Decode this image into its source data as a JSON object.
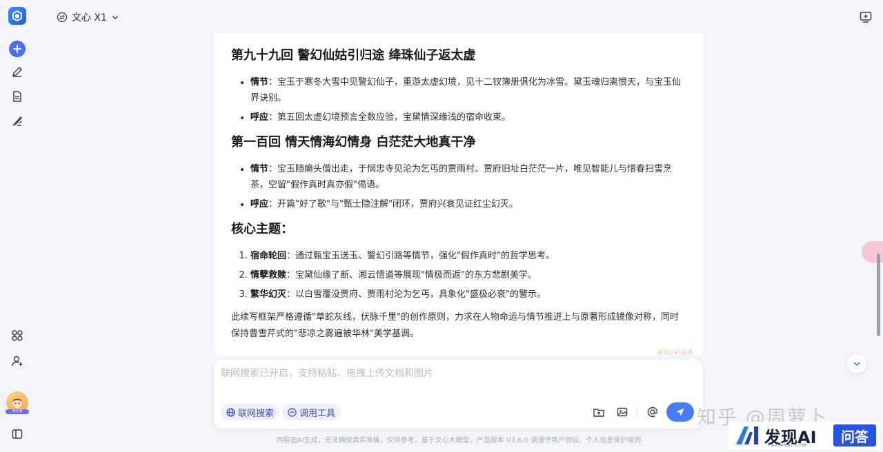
{
  "header": {
    "model_name": "文心 X1"
  },
  "content": {
    "sections": [
      {
        "title": "第九十九回 警幻仙姑引归途 绛珠仙子返太虚",
        "items": [
          {
            "label": "情节",
            "text": "：宝玉于寒冬大雪中见警幻仙子，重游太虚幻境，见十二钗簿册俱化为冰雪。黛玉魂归离恨天，与宝玉仙界诀别。"
          },
          {
            "label": "呼应",
            "text": "：第五回太虚幻境预言全数应验，宝黛情深缘浅的宿命收束。"
          }
        ]
      },
      {
        "title": "第一百回 情天情海幻情身 白茫茫大地真干净",
        "items": [
          {
            "label": "情节",
            "text": "：宝玉随癞头僧出走，于悯忠寺见沦为乞丐的贾雨村。贾府旧址白茫茫一片，唯见智能儿与惜春扫雪烹茶，空留\"假作真时真亦假\"偈语。"
          },
          {
            "label": "呼应",
            "text": "：开篇\"好了歌\"与\"甄士隐注解\"闭环，贾府兴衰见证红尘幻灭。"
          }
        ]
      }
    ],
    "theme_title": "核心主题：",
    "themes": [
      {
        "label": "宿命轮回",
        "text": "：通过甄宝玉送玉、警幻引路等情节，强化\"假作真时\"的哲学思考。"
      },
      {
        "label": "情孽救赎",
        "text": "：宝黛仙缘了断、湘云悟道等展现\"情极而返\"的东方悲剧美学。"
      },
      {
        "label": "繁华幻灭",
        "text": "：以白雪覆没贾府、贾雨村沦为乞丐，具象化\"盛极必衰\"的警示。"
      }
    ],
    "summary": "此续写框架严格遵循\"草蛇灰线，伏脉千里\"的创作原则，力求在人物命运与情节推进上与原著形成镜像对称，同时保持曹雪芹式的\"悲凉之雾遍被华林\"美学基调。",
    "small_watermark": "由文心X1生成"
  },
  "input": {
    "placeholder": "联网搜索已开启，支持粘贴、拖拽上传文档和图片",
    "chip_search": "联网搜索",
    "chip_tools": "调用工具"
  },
  "footer": {
    "disclaimer": "内容由AI生成，无法确保真实准确，仅供参考。基于文心大模型，产品版本 V3.6.0 请遵守用户协议、个人信息保护规则"
  },
  "overlay": {
    "zhihu_watermark": "知乎 @周萝卜",
    "brand_name": "发现AI",
    "brand_sub": "FAXIANAI.COM",
    "brand_qa": "问答",
    "avatar_label": "未评测"
  },
  "colors": {
    "accent": "#4a7cf7",
    "chip_bg": "#eef0ff",
    "sidebar_bg": "#f3f5fa"
  }
}
